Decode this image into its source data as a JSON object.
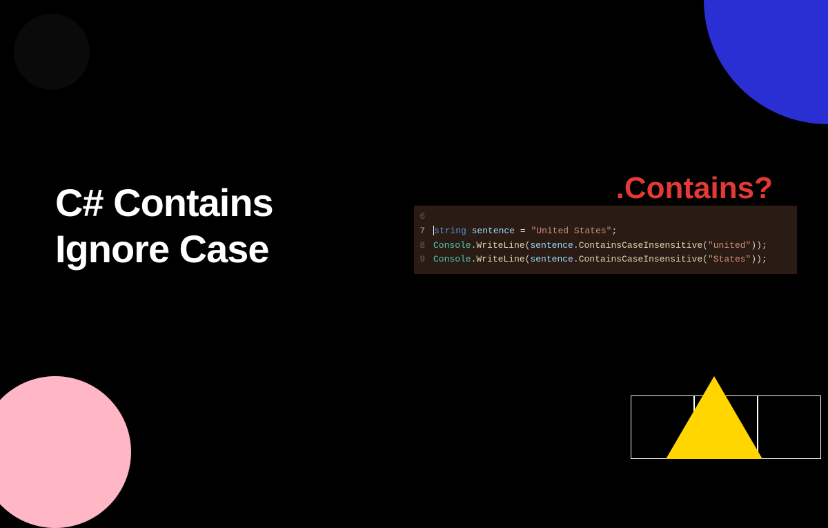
{
  "title": {
    "line1": "C# Contains",
    "line2": "Ignore Case"
  },
  "contains_label": ".Contains?",
  "code": {
    "lines": [
      {
        "num": "6",
        "current": false
      },
      {
        "num": "7",
        "current": true
      },
      {
        "num": "8",
        "current": false
      },
      {
        "num": "9",
        "current": false
      }
    ],
    "line7": {
      "keyword": "string",
      "variable": "sentence",
      "equals": " = ",
      "string_value": "\"United States\"",
      "semicolon": ";"
    },
    "line8": {
      "class": "Console",
      "dot1": ".",
      "method1": "WriteLine",
      "open1": "(",
      "variable": "sentence",
      "dot2": ".",
      "method2": "ContainsCaseInsensitive",
      "open2": "(",
      "string_value": "\"united\"",
      "close": "));"
    },
    "line9": {
      "class": "Console",
      "dot1": ".",
      "method1": "WriteLine",
      "open1": "(",
      "variable": "sentence",
      "dot2": ".",
      "method2": "ContainsCaseInsensitive",
      "open2": "(",
      "string_value": "\"States\"",
      "close": "));"
    }
  }
}
